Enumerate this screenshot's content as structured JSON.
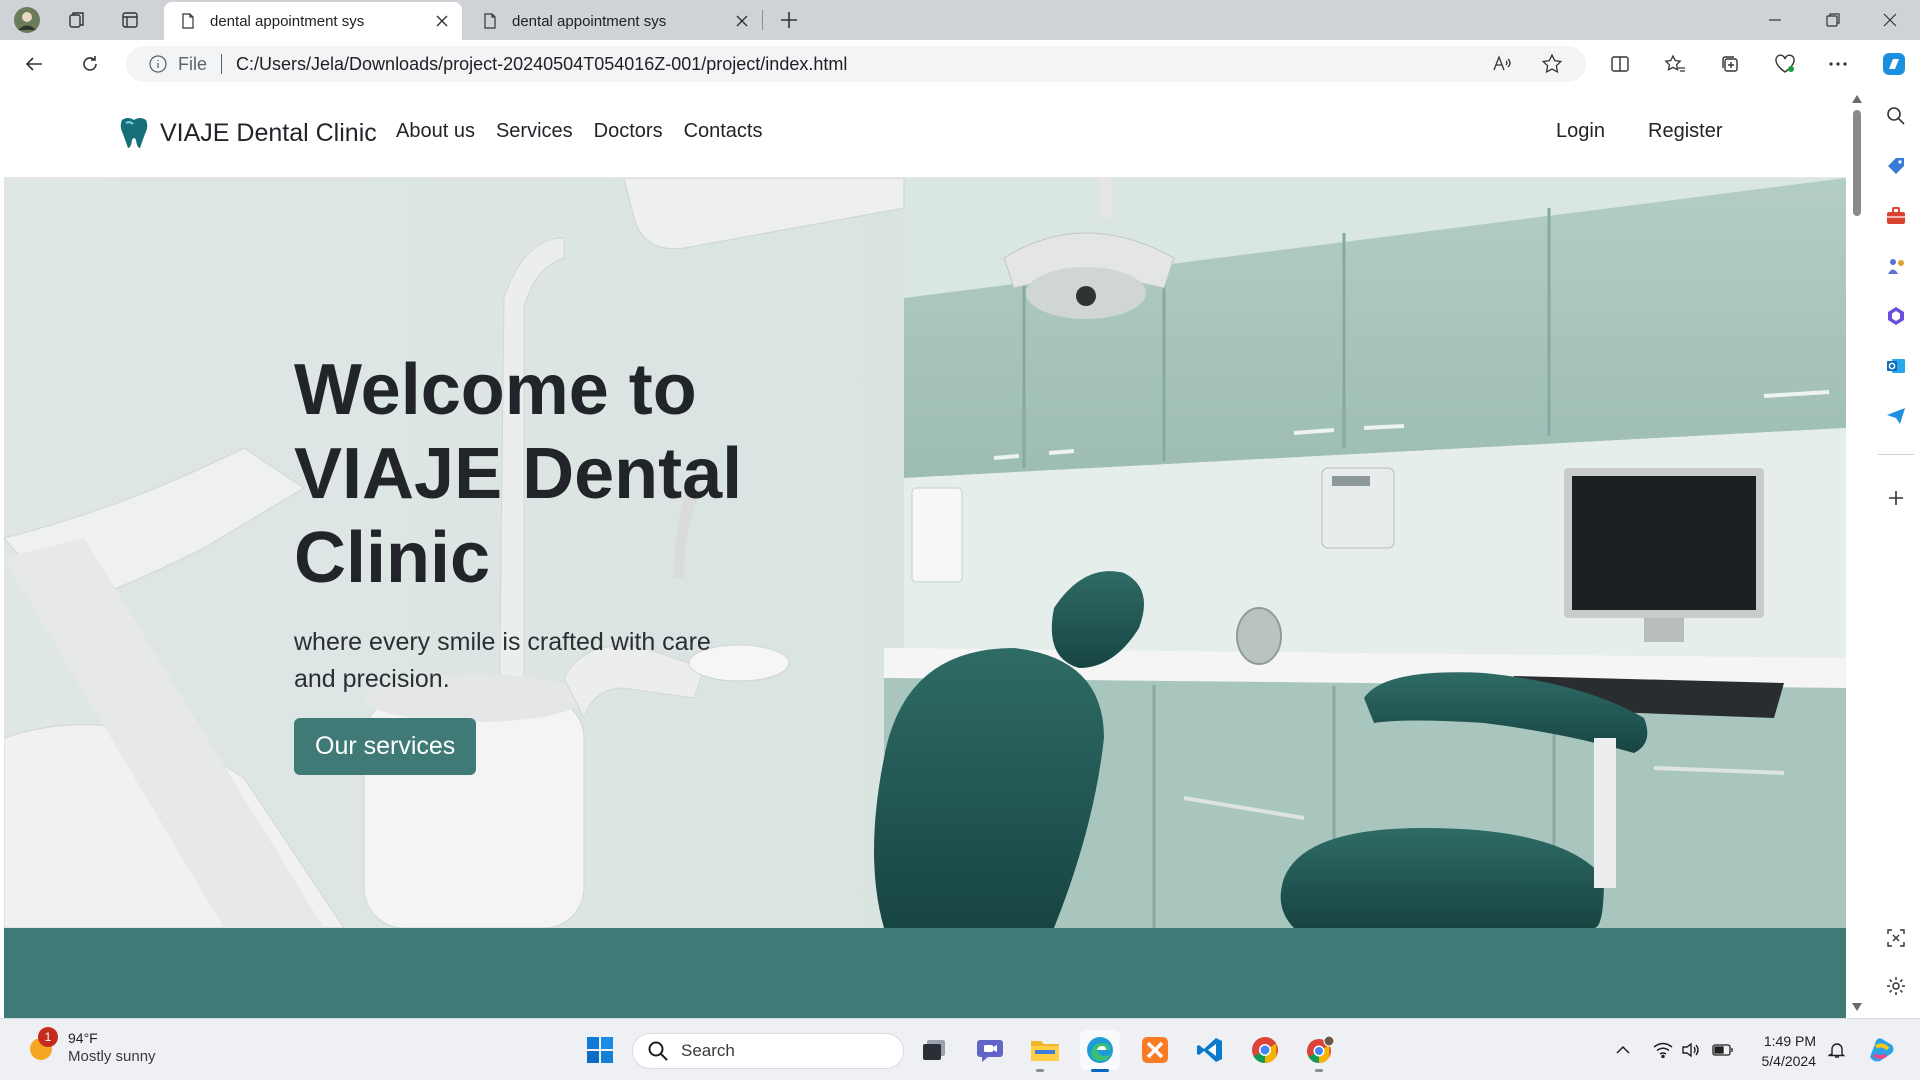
{
  "browser": {
    "tabs": [
      {
        "title": "dental appointment sys",
        "active": true
      },
      {
        "title": "dental appointment sys",
        "active": false
      }
    ],
    "address": {
      "scheme_label": "File",
      "url": "C:/Users/Jela/Downloads/project-20240504T054016Z-001/project/index.html"
    },
    "icons": {
      "back": "back-arrow-icon",
      "reload": "reload-icon",
      "read_aloud": "read-aloud-icon",
      "favorite": "star-icon"
    }
  },
  "site": {
    "brand": "VIAJE Dental Clinic",
    "nav": [
      "About us",
      "Services",
      "Doctors",
      "Contacts"
    ],
    "auth": {
      "login": "Login",
      "register": "Register"
    },
    "hero": {
      "title_lines": [
        "Welcome to",
        "VIAJE Dental",
        "Clinic"
      ],
      "subtitle": "where every smile is crafted with care and precision.",
      "cta": "Our services"
    },
    "accent_color": "#3f7a76"
  },
  "taskbar": {
    "weather": {
      "temp": "94°F",
      "desc": "Mostly sunny",
      "badge": "1"
    },
    "search_placeholder": "Search",
    "clock": {
      "time": "1:49 PM",
      "date": "5/4/2024"
    }
  }
}
